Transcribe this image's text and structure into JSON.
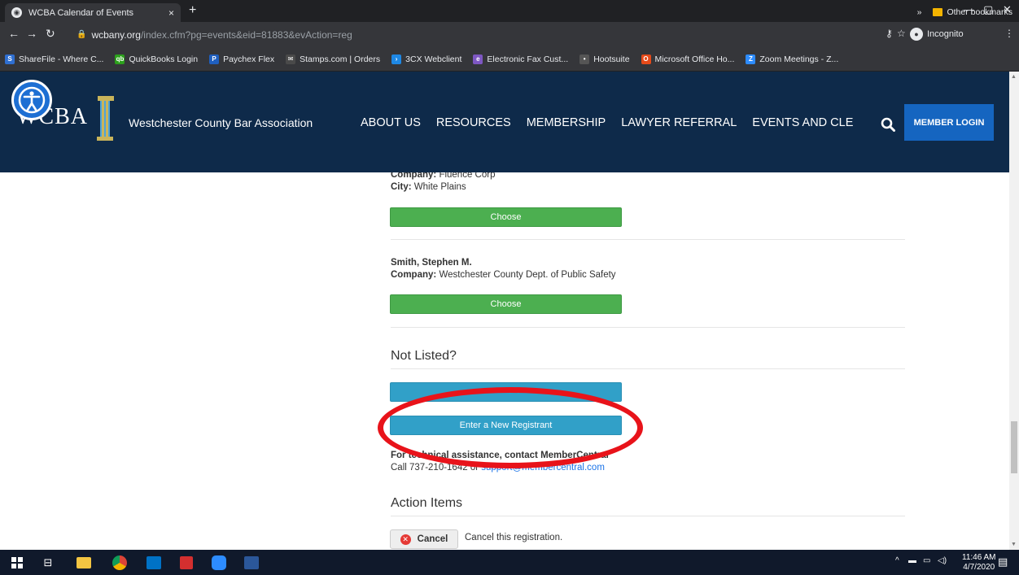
{
  "browser": {
    "tab_title": "WCBA Calendar of Events",
    "tab_close": "×",
    "new_tab": "+",
    "url_host": "wcbany.org",
    "url_path": "/index.cfm?pg=events&eid=81883&evAction=reg",
    "incognito_label": "Incognito"
  },
  "bookmarks": [
    {
      "label": "ShareFile - Where C...",
      "color": "#2f6fd1",
      "glyph": "S"
    },
    {
      "label": "QuickBooks Login",
      "color": "#2ca01c",
      "glyph": "qb"
    },
    {
      "label": "Paychex Flex",
      "color": "#1f5fbf",
      "glyph": "P"
    },
    {
      "label": "Stamps.com | Orders",
      "color": "#4a4a4a",
      "glyph": "✉"
    },
    {
      "label": "3CX Webclient",
      "color": "#1e88e5",
      "glyph": "›"
    },
    {
      "label": "Electronic Fax Cust...",
      "color": "#7e57c2",
      "glyph": "e"
    },
    {
      "label": "Hootsuite",
      "color": "#555555",
      "glyph": "•"
    },
    {
      "label": "Microsoft Office Ho...",
      "color": "#e64a19",
      "glyph": "O"
    },
    {
      "label": "Zoom Meetings - Z...",
      "color": "#2d8cff",
      "glyph": "Z"
    }
  ],
  "bookmarks_right": {
    "more": "»",
    "other": "Other bookmarks"
  },
  "site": {
    "logo": "WCBA",
    "association": "Westchester County Bar Association",
    "nav": [
      "ABOUT US",
      "RESOURCES",
      "MEMBERSHIP",
      "LAWYER REFERRAL",
      "EVENTS AND CLE"
    ],
    "member_login": "MEMBER LOGIN"
  },
  "registrants": {
    "first": {
      "company_label": "Company:",
      "company": "Fluence Corp",
      "city_label": "City:",
      "city": "White Plains",
      "choose": "Choose"
    },
    "second": {
      "name": "Smith, Stephen M.",
      "company_label": "Company:",
      "company": "Westchester County Dept. of Public Safety",
      "choose": "Choose"
    }
  },
  "not_listed": {
    "title": "Not Listed?",
    "enter_new": "Enter a New Registrant"
  },
  "support": {
    "heading": "For technical assistance, contact MemberCentral",
    "call_prefix": "Call 737-210-1642 or ",
    "email": "support@membercentral.com"
  },
  "actions": {
    "title": "Action Items",
    "cancel": "Cancel",
    "cancel_desc": "Cancel this registration."
  },
  "taskbar": {
    "time": "11:46 AM",
    "date": "4/7/2020"
  }
}
